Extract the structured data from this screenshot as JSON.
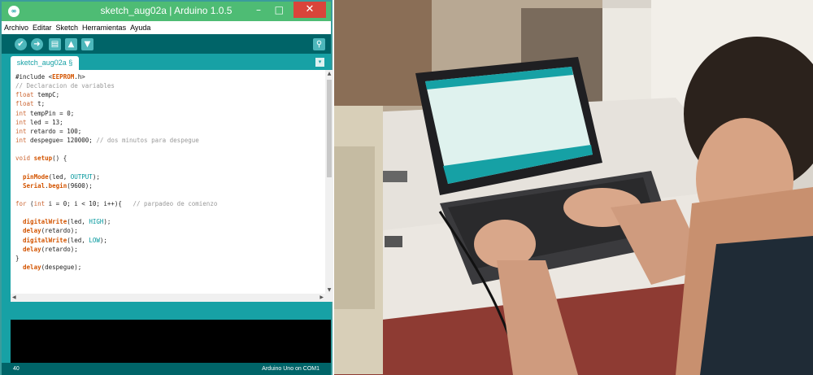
{
  "window": {
    "title": "sketch_aug02a | Arduino 1.0.5",
    "logo_icon": "arduino-logo-icon",
    "controls": {
      "minimize": "–",
      "maximize": "□",
      "close": "✕"
    }
  },
  "menu": [
    "Archivo",
    "Editar",
    "Sketch",
    "Herramientas",
    "Ayuda"
  ],
  "toolbar": {
    "verify_icon": "✔",
    "upload_icon": "➜",
    "new_icon": "▤",
    "open_icon": "▲",
    "save_icon": "▼",
    "monitor_icon": "⚲"
  },
  "tab": {
    "label": "sketch_aug02a §",
    "menu_icon": "▾"
  },
  "code": [
    {
      "cls": "",
      "text": "#include <EEPROM.h>"
    },
    {
      "cls": "cm",
      "text": "// Declaracion de variables"
    },
    {
      "cls": "",
      "text": "float tempC;"
    },
    {
      "cls": "",
      "text": "float t;"
    },
    {
      "cls": "",
      "text": "int tempPin = 0;"
    },
    {
      "cls": "",
      "text": "int led = 13;"
    },
    {
      "cls": "",
      "text": "int retardo = 100;"
    },
    {
      "cls": "",
      "text": "int despegue= 120000; // dos minutos para despegue"
    },
    {
      "cls": "",
      "text": ""
    },
    {
      "cls": "",
      "text": "void setup() {"
    },
    {
      "cls": "",
      "text": ""
    },
    {
      "cls": "",
      "text": "  pinMode(led, OUTPUT);"
    },
    {
      "cls": "",
      "text": "  Serial.begin(9600);"
    },
    {
      "cls": "",
      "text": ""
    },
    {
      "cls": "",
      "text": "for (int i = 0; i < 10; i++){   // parpadeo de comienzo"
    },
    {
      "cls": "",
      "text": ""
    },
    {
      "cls": "",
      "text": "  digitalWrite(led, HIGH);"
    },
    {
      "cls": "",
      "text": "  delay(retardo);"
    },
    {
      "cls": "",
      "text": "  digitalWrite(led, LOW);"
    },
    {
      "cls": "",
      "text": "  delay(retardo);"
    },
    {
      "cls": "",
      "text": "}"
    },
    {
      "cls": "",
      "text": "  delay(despegue);"
    }
  ],
  "status": {
    "line": "40",
    "board": "Arduino Uno on COM1"
  },
  "scroll": {
    "up": "▲",
    "down": "▼",
    "left": "◀",
    "right": "▶"
  },
  "photo": {
    "description_icon": "person-typing-on-laptop-photo"
  }
}
